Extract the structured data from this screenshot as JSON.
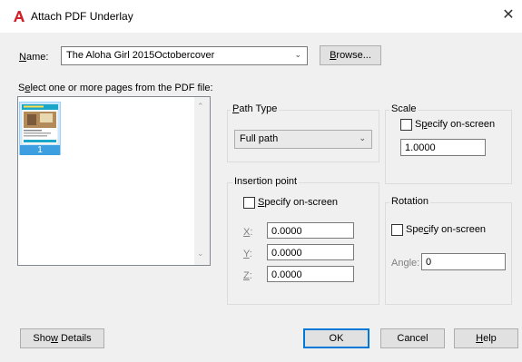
{
  "window": {
    "title": "Attach PDF Underlay",
    "close_glyph": "✕"
  },
  "name_row": {
    "label_pre": "",
    "label_u": "N",
    "label_post": "ame:",
    "value": "The Aloha Girl 2015Octobercover",
    "browse_u": "B",
    "browse_post": "rowse..."
  },
  "pages": {
    "label_pre": "S",
    "label_u": "e",
    "label_post": "lect one or more pages from the PDF file:",
    "items": [
      {
        "number": "1"
      }
    ]
  },
  "path_type": {
    "title_pre": "",
    "title_u": "P",
    "title_post": "ath Type",
    "value": "Full path"
  },
  "insertion_point": {
    "title": "Insertion point",
    "specify_pre": "",
    "specify_u": "S",
    "specify_post": "pecify on-screen",
    "x_u": "X",
    "x_post": ":",
    "x_value": "0.0000",
    "y_u": "Y",
    "y_post": ":",
    "y_value": "0.0000",
    "z_u": "Z",
    "z_post": ":",
    "z_value": "0.0000"
  },
  "scale": {
    "title": "Scale",
    "specify_pre": "S",
    "specify_u": "p",
    "specify_post": "ecify on-screen",
    "value": "1.0000"
  },
  "rotation": {
    "title": "Rotation",
    "specify_pre": "Spe",
    "specify_u": "c",
    "specify_post": "ify on-screen",
    "angle_label": "Angle:",
    "angle_value": "0"
  },
  "buttons": {
    "details_pre": "Sho",
    "details_u": "w",
    "details_post": " Details",
    "ok": "OK",
    "cancel": "Cancel",
    "help_u": "H",
    "help_post": "elp"
  },
  "colors": {
    "brand_icon": "#d0202a",
    "dialog_bg": "#f0f0f0",
    "selection": "#cce8ff",
    "default_button_border": "#0078d7"
  }
}
